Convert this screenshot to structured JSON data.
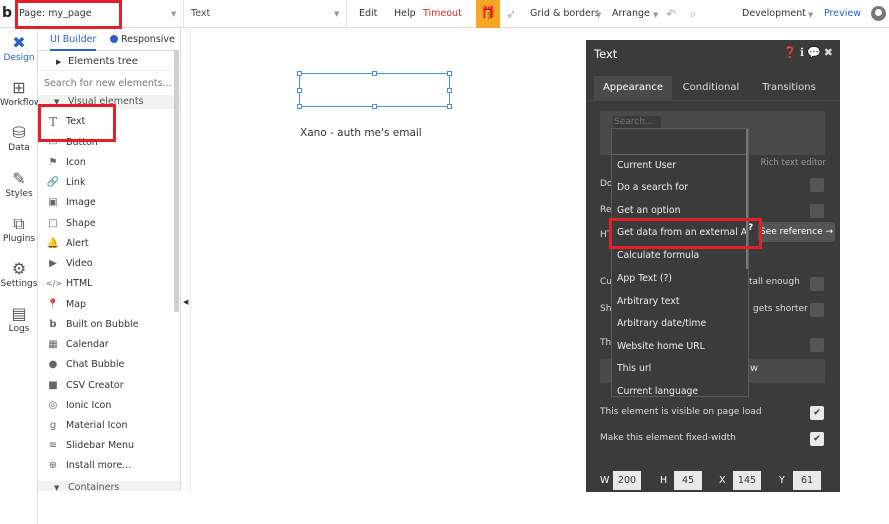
{
  "topbar": {
    "logo": "b",
    "page_selector": "Page: my_page",
    "element_selector": "Text",
    "edit": "Edit",
    "help": "Help",
    "timeout": "Timeout",
    "grid_borders": "Grid & borders",
    "arrange": "Arrange",
    "environment": "Development",
    "preview": "Preview"
  },
  "rail": {
    "items": [
      {
        "label": "Design",
        "icon": "design-icon"
      },
      {
        "label": "Workflow",
        "icon": "workflow-icon"
      },
      {
        "label": "Data",
        "icon": "database-icon"
      },
      {
        "label": "Styles",
        "icon": "brush-icon"
      },
      {
        "label": "Plugins",
        "icon": "plugin-icon"
      },
      {
        "label": "Settings",
        "icon": "gear-icon"
      },
      {
        "label": "Logs",
        "icon": "logs-icon"
      }
    ]
  },
  "panel": {
    "tabs": {
      "ui_builder": "UI Builder",
      "responsive": "Responsive"
    },
    "elements_tree": "Elements tree",
    "search_placeholder": "Search for new elements...",
    "visual_section": "Visual elements",
    "containers_section": "Containers",
    "items": [
      {
        "label": "Text",
        "icon": "T"
      },
      {
        "label": "Button",
        "icon": "▭"
      },
      {
        "label": "Icon",
        "icon": "⚑"
      },
      {
        "label": "Link",
        "icon": "🔗"
      },
      {
        "label": "Image",
        "icon": "▣"
      },
      {
        "label": "Shape",
        "icon": "□"
      },
      {
        "label": "Alert",
        "icon": "🔔"
      },
      {
        "label": "Video",
        "icon": "▶"
      },
      {
        "label": "HTML",
        "icon": "</>"
      },
      {
        "label": "Map",
        "icon": "📍"
      },
      {
        "label": "Built on Bubble",
        "icon": "b"
      },
      {
        "label": "Calendar",
        "icon": "▦"
      },
      {
        "label": "Chat Bubble",
        "icon": "●"
      },
      {
        "label": "CSV Creator",
        "icon": "■"
      },
      {
        "label": "Ionic Icon",
        "icon": "◎"
      },
      {
        "label": "Material Icon",
        "icon": "g"
      },
      {
        "label": "Slidebar Menu",
        "icon": "≡"
      },
      {
        "label": "Install more...",
        "icon": "⊕"
      }
    ]
  },
  "canvas": {
    "text": "Xano - auth me's email"
  },
  "property_editor": {
    "title": "Text",
    "tabs": [
      "Appearance",
      "Conditional",
      "Transitions"
    ],
    "rich_text_note": "Rich text editor",
    "see_reference": "See reference →",
    "row_labels": [
      "Do",
      "Re",
      "HT",
      "Cu",
      "Sh",
      "Th"
    ],
    "row_suffixes": {
      "cu": "tall enough",
      "sh": "gets shorter",
      "th_btn": "w"
    },
    "visible_on_load": "This element is visible on page load",
    "fixed_width": "Make this element fixed-width",
    "dims": {
      "w_label": "W",
      "w": "200",
      "h_label": "H",
      "h": "45",
      "x_label": "X",
      "x": "145",
      "y_label": "Y",
      "y": "61"
    }
  },
  "dropdown": {
    "search_placeholder": "Search...",
    "items": [
      "Current User",
      "Do a search for",
      "Get an option",
      "Get data from an external API",
      "Calculate formula",
      "App Text (?)",
      "Arbitrary text",
      "Arbitrary date/time",
      "Website home URL",
      "This url",
      "Current language"
    ]
  }
}
